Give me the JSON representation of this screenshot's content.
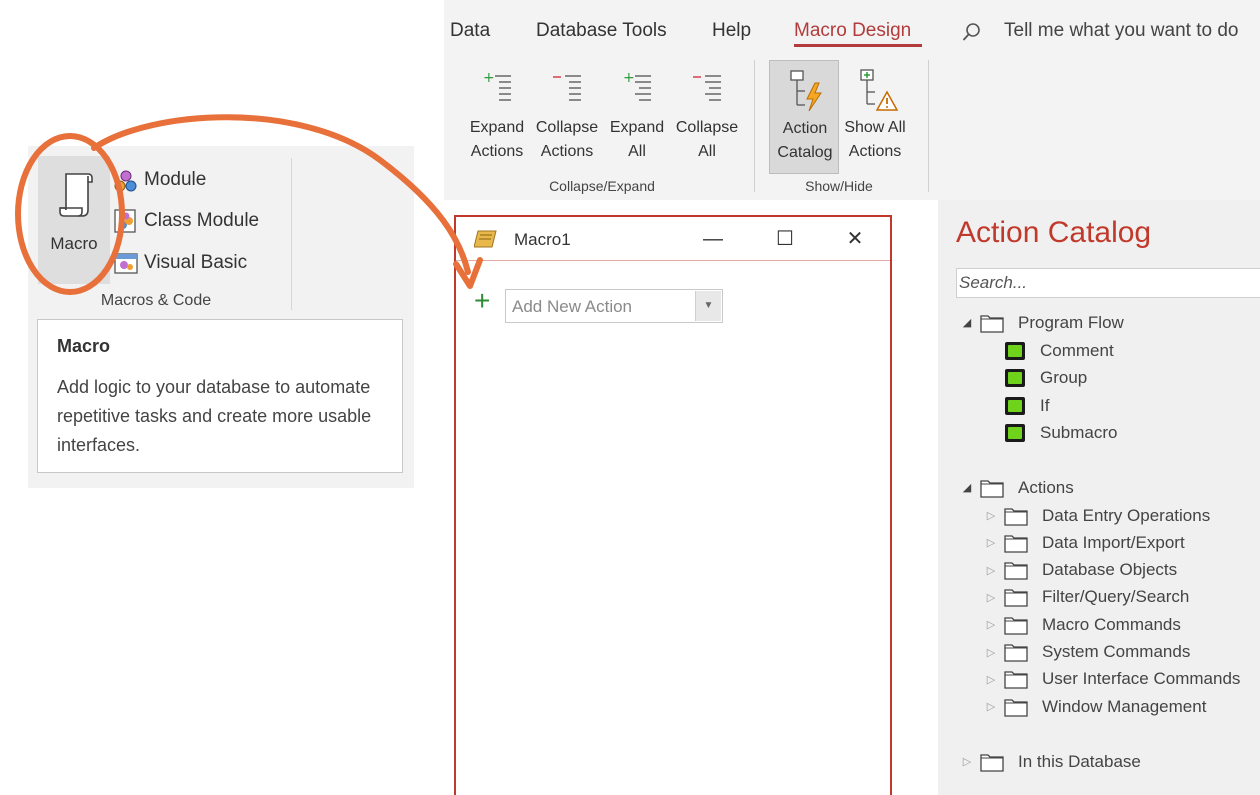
{
  "left_ribbon": {
    "macro_label": "Macro",
    "module_label": "Module",
    "class_module_label": "Class Module",
    "visual_basic_label": "Visual Basic",
    "group_label": "Macros & Code"
  },
  "tooltip": {
    "title": "Macro",
    "body": "Add logic to your database to automate repetitive tasks and create more usable interfaces."
  },
  "ribbon": {
    "tabs": [
      "Data",
      "Database Tools",
      "Help",
      "Macro Design"
    ],
    "active_tab": "Macro Design",
    "tell_me": "Tell me what you want to do",
    "buttons": {
      "expand_actions": [
        "Expand",
        "Actions"
      ],
      "collapse_actions": [
        "Collapse",
        "Actions"
      ],
      "expand_all": [
        "Expand",
        "All"
      ],
      "collapse_all": [
        "Collapse",
        "All"
      ],
      "action_catalog": [
        "Action",
        "Catalog"
      ],
      "show_all_actions": [
        "Show All",
        "Actions"
      ]
    },
    "groups": {
      "collapse_expand": "Collapse/Expand",
      "show_hide": "Show/Hide"
    }
  },
  "macro_window": {
    "title": "Macro1",
    "minimize": "—",
    "maximize": "☐",
    "close": "✕",
    "add_new_action_placeholder": "Add New Action"
  },
  "catalog": {
    "title": "Action Catalog",
    "search_placeholder": "Search...",
    "program_flow": {
      "label": "Program Flow",
      "items": [
        "Comment",
        "Group",
        "If",
        "Submacro"
      ]
    },
    "actions": {
      "label": "Actions",
      "items": [
        "Data Entry Operations",
        "Data Import/Export",
        "Database Objects",
        "Filter/Query/Search",
        "Macro Commands",
        "System Commands",
        "User Interface Commands",
        "Window Management"
      ]
    },
    "in_this_database": "In this Database"
  },
  "colors": {
    "accent": "#c0392b",
    "annotation_orange": "#e8703a",
    "green_plus": "#2e8b35",
    "item_icon_green": "#6fd21b"
  },
  "icons": [
    "scroll-icon",
    "module-icon",
    "class-module-icon",
    "visual-basic-icon",
    "search-icon",
    "expand-actions-icon",
    "collapse-actions-icon",
    "expand-all-icon",
    "collapse-all-icon",
    "action-catalog-icon",
    "show-all-actions-icon",
    "macro-scroll-icon",
    "folder-icon",
    "flow-item-icon",
    "plus-icon",
    "chevron-down-icon"
  ]
}
